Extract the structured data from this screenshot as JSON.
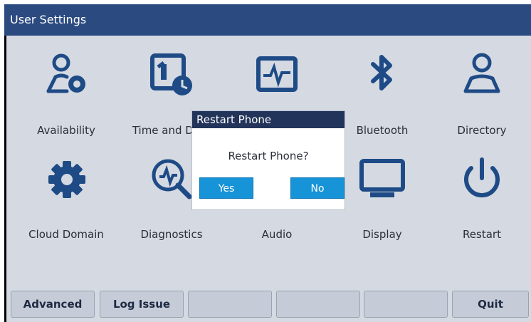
{
  "window": {
    "title": "User Settings"
  },
  "tiles": [
    {
      "label": "Availability",
      "icon": "availability-icon"
    },
    {
      "label": "Time and Date",
      "icon": "calendar-clock-icon"
    },
    {
      "label": "",
      "icon": "pulse-monitor-icon"
    },
    {
      "label": "Bluetooth",
      "icon": "bluetooth-icon"
    },
    {
      "label": "Directory",
      "icon": "person-icon"
    },
    {
      "label": "Cloud Domain",
      "icon": "gear-icon"
    },
    {
      "label": "Diagnostics",
      "icon": "diagnostics-icon"
    },
    {
      "label": "Audio",
      "icon": "speaker-icon"
    },
    {
      "label": "Display",
      "icon": "monitor-icon"
    },
    {
      "label": "Restart",
      "icon": "power-icon"
    }
  ],
  "dialog": {
    "title": "Restart Phone",
    "message": "Restart Phone?",
    "yes": "Yes",
    "no": "No"
  },
  "softkeys": [
    "Advanced",
    "Log Issue",
    "",
    "",
    "",
    "Quit"
  ],
  "colors": {
    "titlebar": "#2b4a80",
    "icon": "#1e4b86",
    "button": "#1793d8",
    "background": "#d4d9e2"
  }
}
